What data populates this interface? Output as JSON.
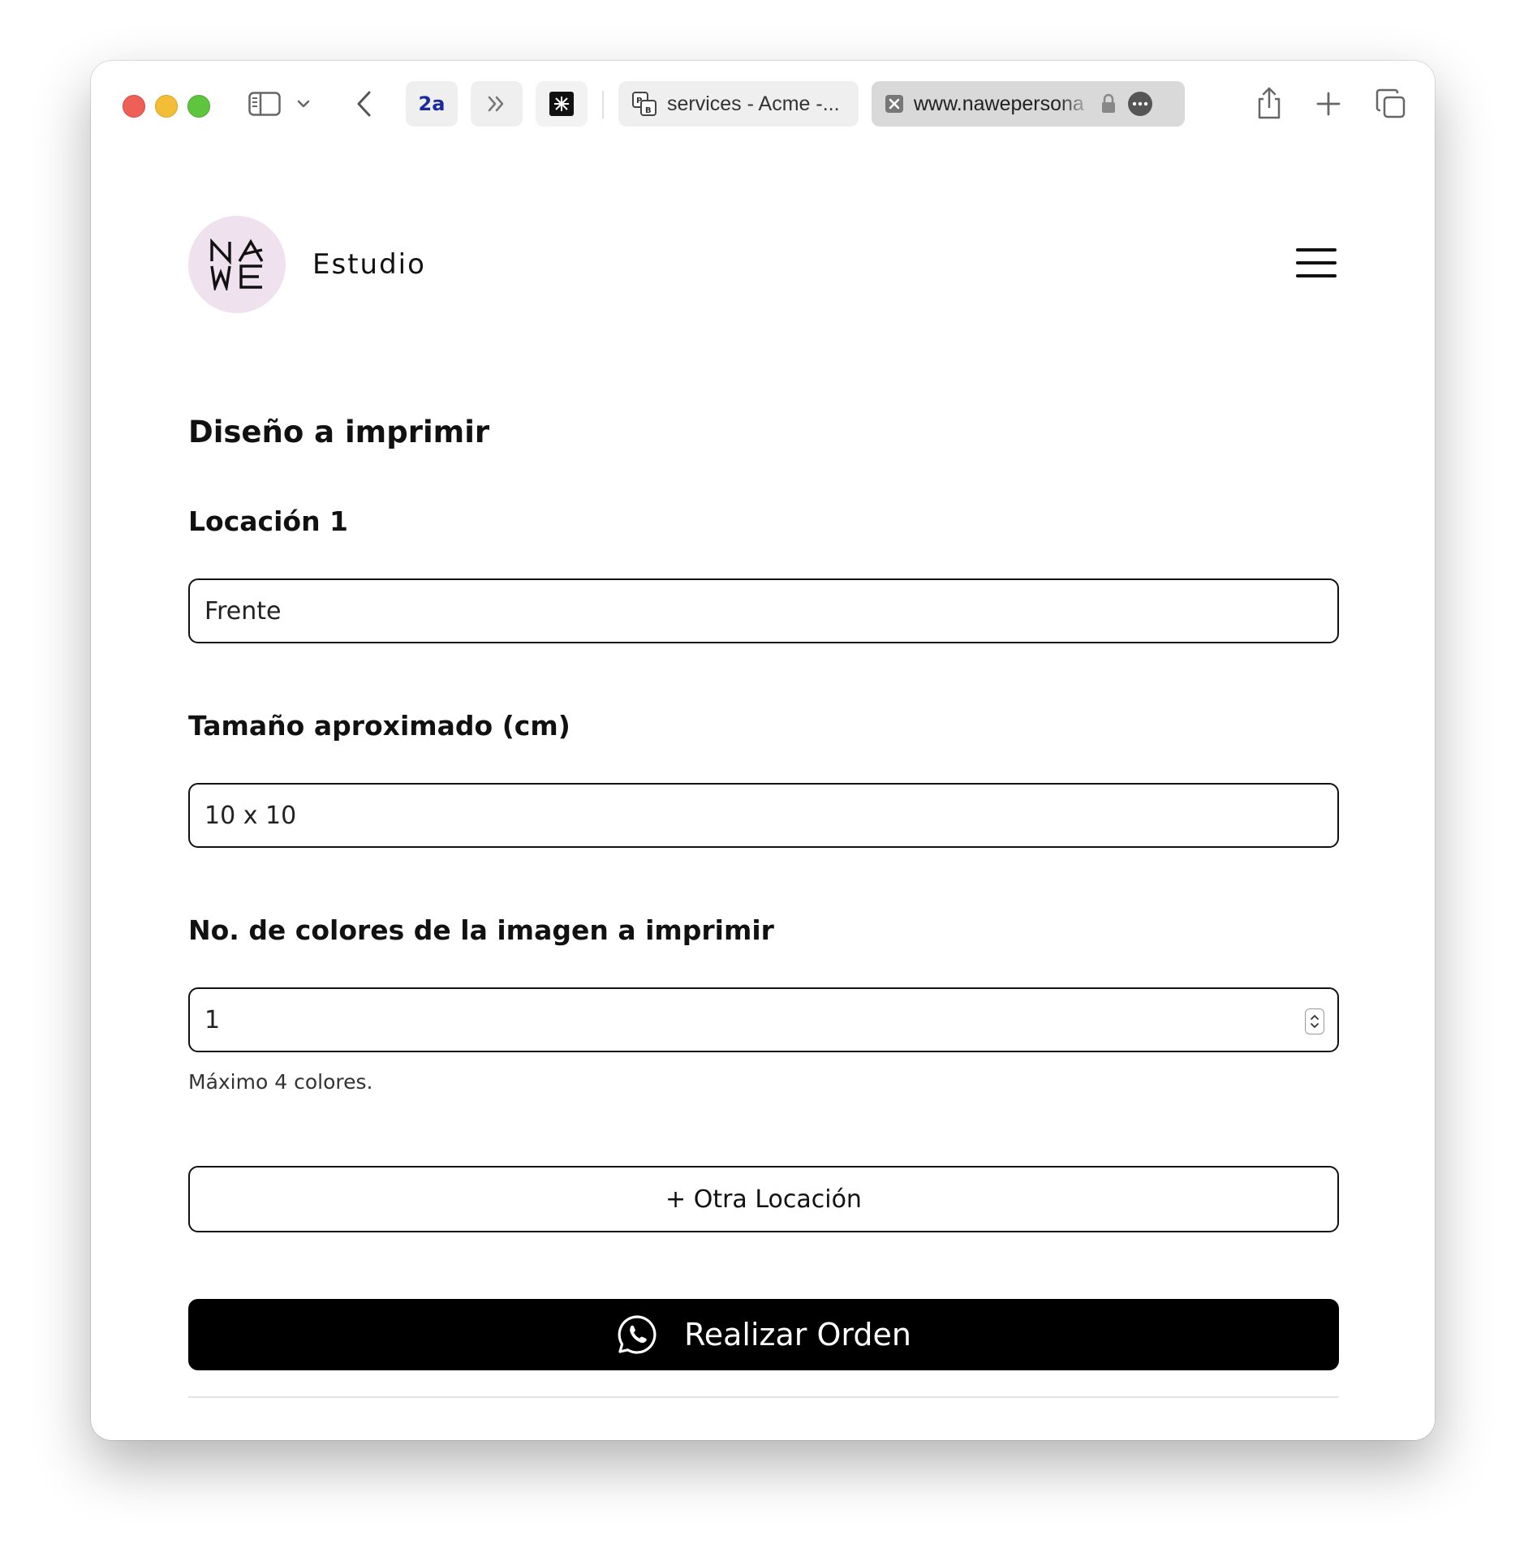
{
  "browser": {
    "toolbar": {
      "profile_badge": "2a"
    },
    "tabs": [
      {
        "title": "services - Acme -...",
        "favicon": "pb-icon",
        "active": false
      },
      {
        "title": "www.nawepersona",
        "favicon": "close-tab-icon",
        "active": true
      }
    ],
    "icons": {
      "sidebar": "sidebar-icon",
      "chevron": "chevron-down-icon",
      "back": "back-icon",
      "forward": "double-chevron-right-icon",
      "extension": "extension-icon",
      "lock": "lock-icon",
      "more": "more-icon",
      "share": "share-icon",
      "new_tab": "plus-icon",
      "tabs_overview": "tabs-overview-icon"
    },
    "traffic_colors": {
      "close": "#ee5f57",
      "minimize": "#f4bd38",
      "zoom": "#5fc53f"
    }
  },
  "site": {
    "logo": {
      "line1": "NA",
      "line2": "WE",
      "bg_color": "#efe2ee"
    },
    "brand": "Estudio",
    "menu_icon": "hamburger-icon"
  },
  "form": {
    "section_title": "Diseño a imprimir",
    "location": {
      "label": "Locación 1",
      "value": "Frente"
    },
    "size": {
      "label": "Tamaño aproximado (cm)",
      "value": "10 x 10"
    },
    "colors": {
      "label": "No. de colores de la imagen a imprimir",
      "value": "1",
      "hint": "Máximo 4 colores."
    },
    "add_location_label": "+ Otra Locación",
    "submit": {
      "label": "Realizar Orden",
      "icon": "whatsapp-icon",
      "bg_color": "#000000"
    }
  }
}
